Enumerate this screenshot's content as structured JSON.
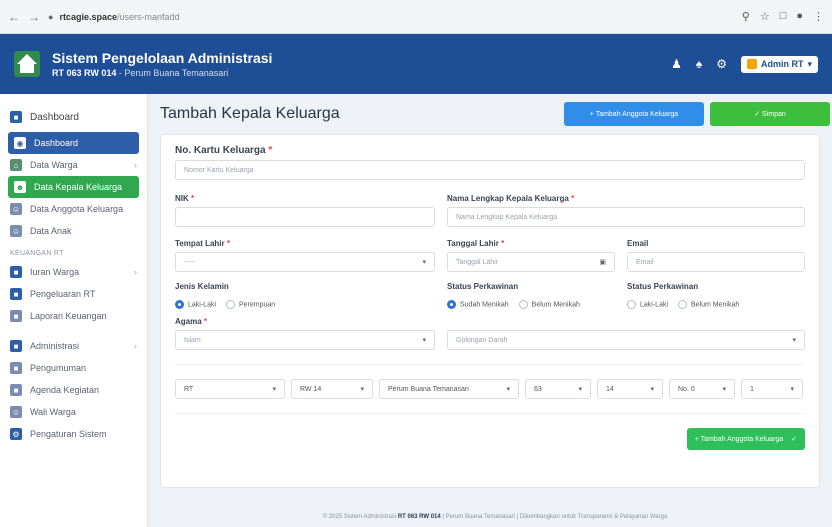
{
  "browser": {
    "url_host": "rtcagie.space",
    "url_path": "/users-manfadd",
    "back": "←",
    "forward": "→"
  },
  "app": {
    "title": "Sistem Pengelolaan Administrasi",
    "subtitle_bold": "RT 063 RW 014",
    "subtitle_rest": "- Perum Buana Temanasari",
    "admin_label": "Admin RT"
  },
  "sidebar": {
    "top_item": "Dashboard",
    "items": [
      {
        "label": "Dashboard"
      },
      {
        "label": "Data Warga"
      },
      {
        "label": "Data Kepala Keluarga"
      },
      {
        "label": "Data Anggota Keluarga"
      },
      {
        "label": "Data Anak"
      }
    ],
    "section_label": "KEUANGAN RT",
    "finance_items": [
      {
        "label": "Iuran Warga"
      },
      {
        "label": "Pengeluaran RT"
      },
      {
        "label": "Laporan Keuangan"
      }
    ],
    "admin_items": [
      {
        "label": "Administrasi"
      },
      {
        "label": "Pengumuman"
      },
      {
        "label": "Agenda Kegiatan"
      },
      {
        "label": "Wali Warga"
      },
      {
        "label": "Pengaturan Sistem"
      }
    ]
  },
  "page": {
    "title": "Tambah Kepala Keluarga",
    "btn_add_member": "+ Tambah Anggota Keluarga",
    "btn_save": "✓ Simpan"
  },
  "form": {
    "kk_label": "No. Kartu Keluarga",
    "kk_placeholder": "Nomor Kartu Keluarga",
    "nik_label": "NIK",
    "nama_label": "Nama Lengkap Kepala Keluarga",
    "nama_placeholder": "Nama Lengkap Kepala Keluarga",
    "tempat_label": "Tempat Lahir",
    "tempat_value": "-----",
    "tanggal_label": "Tanggal Lahir",
    "tanggal_placeholder": "Tanggal Lahir",
    "email_label": "Email",
    "email_placeholder": "Email",
    "jk_label": "Jenis Kelamin",
    "jk_options": [
      "Laki-Laki",
      "Perempuan"
    ],
    "status_kawin_label": "Status Perkawinan",
    "status_kawin_options": [
      "Sudah Menikah",
      "Belum Menikah"
    ],
    "status_kawin2_label": "Status Perkawinan",
    "status_kawin2_options": [
      "Laki-Laki",
      "Belum Menikah"
    ],
    "agama_label": "Agama",
    "agama_value": "Islam",
    "gol_darah_value": "Golongan Darah",
    "addr": {
      "rt": "RT",
      "rw": "RW",
      "rw_value": "14",
      "perum": "Perum Buana Temanasari",
      "blok": "63",
      "no_rw": "14",
      "no_label": "No. 0",
      "no_value": "1"
    },
    "footer_btn": "+ Tambah Anggota Keluarga"
  },
  "footer": {
    "text_pre": "© 2025 Sistem Administrasi",
    "text_bold": "RT 063 RW 014",
    "text_post": "| Perum Buana Temanasari | Dikembangkan untuk Transparansi & Pelayanan Warga"
  }
}
